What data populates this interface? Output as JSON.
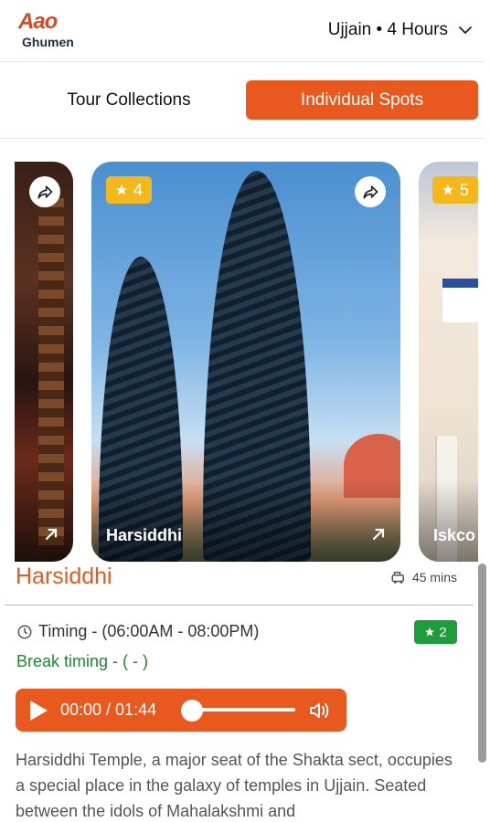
{
  "header": {
    "logo_top": "Aao",
    "logo_bottom": "Ghumen",
    "location_label": "Ujjain • 4 Hours"
  },
  "tabs": [
    {
      "label": "Tour Collections",
      "active": false
    },
    {
      "label": "Individual Spots",
      "active": true
    }
  ],
  "carousel": {
    "cards": [
      {
        "title": "",
        "rating": ""
      },
      {
        "title": "Harsiddhi",
        "rating": "4"
      },
      {
        "title": "Iskco",
        "rating": "5"
      }
    ]
  },
  "detail": {
    "title": "Harsiddhi",
    "duration": "45 mins",
    "timing": "Timing - (06:00AM - 08:00PM)",
    "rating": "2",
    "break_timing": "Break timing - ( - )",
    "audio": {
      "time": "00:00 / 01:44",
      "progress": 0
    },
    "description": "Harsiddhi Temple, a major seat of the Shakta sect, occupies a special place in the galaxy of temples in Ujjain. Seated between the idols of Mahalakshmi and"
  },
  "colors": {
    "accent": "#e9581f",
    "rating_badge": "#f5b81c",
    "success": "#1e9d3c",
    "break_text": "#1b8a2e"
  }
}
